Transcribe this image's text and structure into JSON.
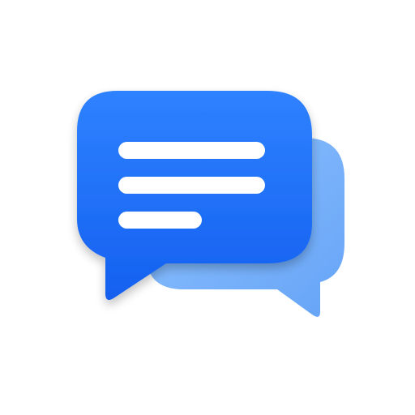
{
  "icon": {
    "name": "chat-bubbles-icon",
    "colors": {
      "front_bubble_top": "#2F82FF",
      "front_bubble_bottom": "#1460F0",
      "back_bubble_top": "#7DB9FF",
      "back_bubble_bottom": "#4A93F5",
      "text_lines": "#FFFFFF",
      "background": "#FFFFFF"
    },
    "text_lines_count": 3
  }
}
